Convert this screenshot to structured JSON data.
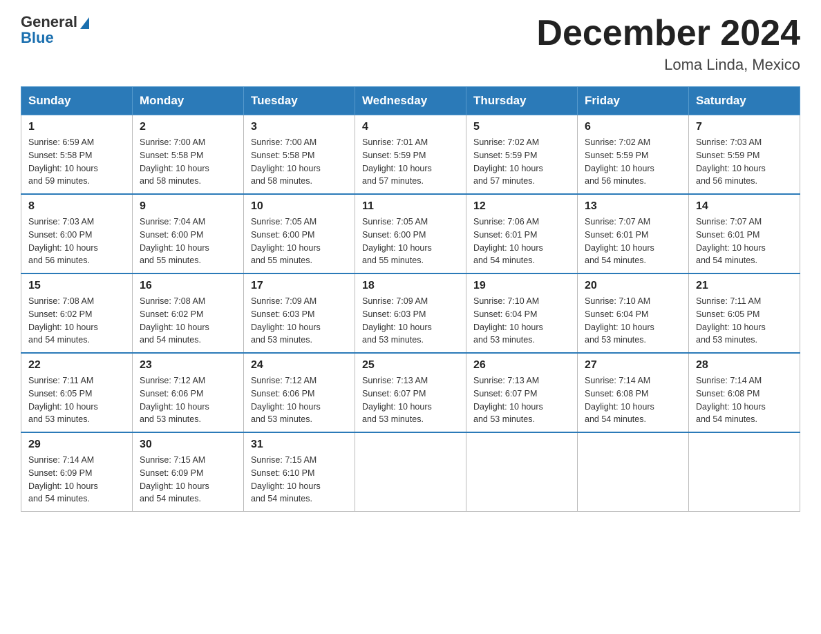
{
  "header": {
    "logo_general": "General",
    "logo_blue": "Blue",
    "month_title": "December 2024",
    "location": "Loma Linda, Mexico"
  },
  "days_of_week": [
    "Sunday",
    "Monday",
    "Tuesday",
    "Wednesday",
    "Thursday",
    "Friday",
    "Saturday"
  ],
  "weeks": [
    [
      {
        "day": "1",
        "sunrise": "Sunrise: 6:59 AM",
        "sunset": "Sunset: 5:58 PM",
        "daylight": "Daylight: 10 hours",
        "daylight2": "and 59 minutes."
      },
      {
        "day": "2",
        "sunrise": "Sunrise: 7:00 AM",
        "sunset": "Sunset: 5:58 PM",
        "daylight": "Daylight: 10 hours",
        "daylight2": "and 58 minutes."
      },
      {
        "day": "3",
        "sunrise": "Sunrise: 7:00 AM",
        "sunset": "Sunset: 5:58 PM",
        "daylight": "Daylight: 10 hours",
        "daylight2": "and 58 minutes."
      },
      {
        "day": "4",
        "sunrise": "Sunrise: 7:01 AM",
        "sunset": "Sunset: 5:59 PM",
        "daylight": "Daylight: 10 hours",
        "daylight2": "and 57 minutes."
      },
      {
        "day": "5",
        "sunrise": "Sunrise: 7:02 AM",
        "sunset": "Sunset: 5:59 PM",
        "daylight": "Daylight: 10 hours",
        "daylight2": "and 57 minutes."
      },
      {
        "day": "6",
        "sunrise": "Sunrise: 7:02 AM",
        "sunset": "Sunset: 5:59 PM",
        "daylight": "Daylight: 10 hours",
        "daylight2": "and 56 minutes."
      },
      {
        "day": "7",
        "sunrise": "Sunrise: 7:03 AM",
        "sunset": "Sunset: 5:59 PM",
        "daylight": "Daylight: 10 hours",
        "daylight2": "and 56 minutes."
      }
    ],
    [
      {
        "day": "8",
        "sunrise": "Sunrise: 7:03 AM",
        "sunset": "Sunset: 6:00 PM",
        "daylight": "Daylight: 10 hours",
        "daylight2": "and 56 minutes."
      },
      {
        "day": "9",
        "sunrise": "Sunrise: 7:04 AM",
        "sunset": "Sunset: 6:00 PM",
        "daylight": "Daylight: 10 hours",
        "daylight2": "and 55 minutes."
      },
      {
        "day": "10",
        "sunrise": "Sunrise: 7:05 AM",
        "sunset": "Sunset: 6:00 PM",
        "daylight": "Daylight: 10 hours",
        "daylight2": "and 55 minutes."
      },
      {
        "day": "11",
        "sunrise": "Sunrise: 7:05 AM",
        "sunset": "Sunset: 6:00 PM",
        "daylight": "Daylight: 10 hours",
        "daylight2": "and 55 minutes."
      },
      {
        "day": "12",
        "sunrise": "Sunrise: 7:06 AM",
        "sunset": "Sunset: 6:01 PM",
        "daylight": "Daylight: 10 hours",
        "daylight2": "and 54 minutes."
      },
      {
        "day": "13",
        "sunrise": "Sunrise: 7:07 AM",
        "sunset": "Sunset: 6:01 PM",
        "daylight": "Daylight: 10 hours",
        "daylight2": "and 54 minutes."
      },
      {
        "day": "14",
        "sunrise": "Sunrise: 7:07 AM",
        "sunset": "Sunset: 6:01 PM",
        "daylight": "Daylight: 10 hours",
        "daylight2": "and 54 minutes."
      }
    ],
    [
      {
        "day": "15",
        "sunrise": "Sunrise: 7:08 AM",
        "sunset": "Sunset: 6:02 PM",
        "daylight": "Daylight: 10 hours",
        "daylight2": "and 54 minutes."
      },
      {
        "day": "16",
        "sunrise": "Sunrise: 7:08 AM",
        "sunset": "Sunset: 6:02 PM",
        "daylight": "Daylight: 10 hours",
        "daylight2": "and 54 minutes."
      },
      {
        "day": "17",
        "sunrise": "Sunrise: 7:09 AM",
        "sunset": "Sunset: 6:03 PM",
        "daylight": "Daylight: 10 hours",
        "daylight2": "and 53 minutes."
      },
      {
        "day": "18",
        "sunrise": "Sunrise: 7:09 AM",
        "sunset": "Sunset: 6:03 PM",
        "daylight": "Daylight: 10 hours",
        "daylight2": "and 53 minutes."
      },
      {
        "day": "19",
        "sunrise": "Sunrise: 7:10 AM",
        "sunset": "Sunset: 6:04 PM",
        "daylight": "Daylight: 10 hours",
        "daylight2": "and 53 minutes."
      },
      {
        "day": "20",
        "sunrise": "Sunrise: 7:10 AM",
        "sunset": "Sunset: 6:04 PM",
        "daylight": "Daylight: 10 hours",
        "daylight2": "and 53 minutes."
      },
      {
        "day": "21",
        "sunrise": "Sunrise: 7:11 AM",
        "sunset": "Sunset: 6:05 PM",
        "daylight": "Daylight: 10 hours",
        "daylight2": "and 53 minutes."
      }
    ],
    [
      {
        "day": "22",
        "sunrise": "Sunrise: 7:11 AM",
        "sunset": "Sunset: 6:05 PM",
        "daylight": "Daylight: 10 hours",
        "daylight2": "and 53 minutes."
      },
      {
        "day": "23",
        "sunrise": "Sunrise: 7:12 AM",
        "sunset": "Sunset: 6:06 PM",
        "daylight": "Daylight: 10 hours",
        "daylight2": "and 53 minutes."
      },
      {
        "day": "24",
        "sunrise": "Sunrise: 7:12 AM",
        "sunset": "Sunset: 6:06 PM",
        "daylight": "Daylight: 10 hours",
        "daylight2": "and 53 minutes."
      },
      {
        "day": "25",
        "sunrise": "Sunrise: 7:13 AM",
        "sunset": "Sunset: 6:07 PM",
        "daylight": "Daylight: 10 hours",
        "daylight2": "and 53 minutes."
      },
      {
        "day": "26",
        "sunrise": "Sunrise: 7:13 AM",
        "sunset": "Sunset: 6:07 PM",
        "daylight": "Daylight: 10 hours",
        "daylight2": "and 53 minutes."
      },
      {
        "day": "27",
        "sunrise": "Sunrise: 7:14 AM",
        "sunset": "Sunset: 6:08 PM",
        "daylight": "Daylight: 10 hours",
        "daylight2": "and 54 minutes."
      },
      {
        "day": "28",
        "sunrise": "Sunrise: 7:14 AM",
        "sunset": "Sunset: 6:08 PM",
        "daylight": "Daylight: 10 hours",
        "daylight2": "and 54 minutes."
      }
    ],
    [
      {
        "day": "29",
        "sunrise": "Sunrise: 7:14 AM",
        "sunset": "Sunset: 6:09 PM",
        "daylight": "Daylight: 10 hours",
        "daylight2": "and 54 minutes."
      },
      {
        "day": "30",
        "sunrise": "Sunrise: 7:15 AM",
        "sunset": "Sunset: 6:09 PM",
        "daylight": "Daylight: 10 hours",
        "daylight2": "and 54 minutes."
      },
      {
        "day": "31",
        "sunrise": "Sunrise: 7:15 AM",
        "sunset": "Sunset: 6:10 PM",
        "daylight": "Daylight: 10 hours",
        "daylight2": "and 54 minutes."
      },
      {
        "day": "",
        "sunrise": "",
        "sunset": "",
        "daylight": "",
        "daylight2": ""
      },
      {
        "day": "",
        "sunrise": "",
        "sunset": "",
        "daylight": "",
        "daylight2": ""
      },
      {
        "day": "",
        "sunrise": "",
        "sunset": "",
        "daylight": "",
        "daylight2": ""
      },
      {
        "day": "",
        "sunrise": "",
        "sunset": "",
        "daylight": "",
        "daylight2": ""
      }
    ]
  ]
}
